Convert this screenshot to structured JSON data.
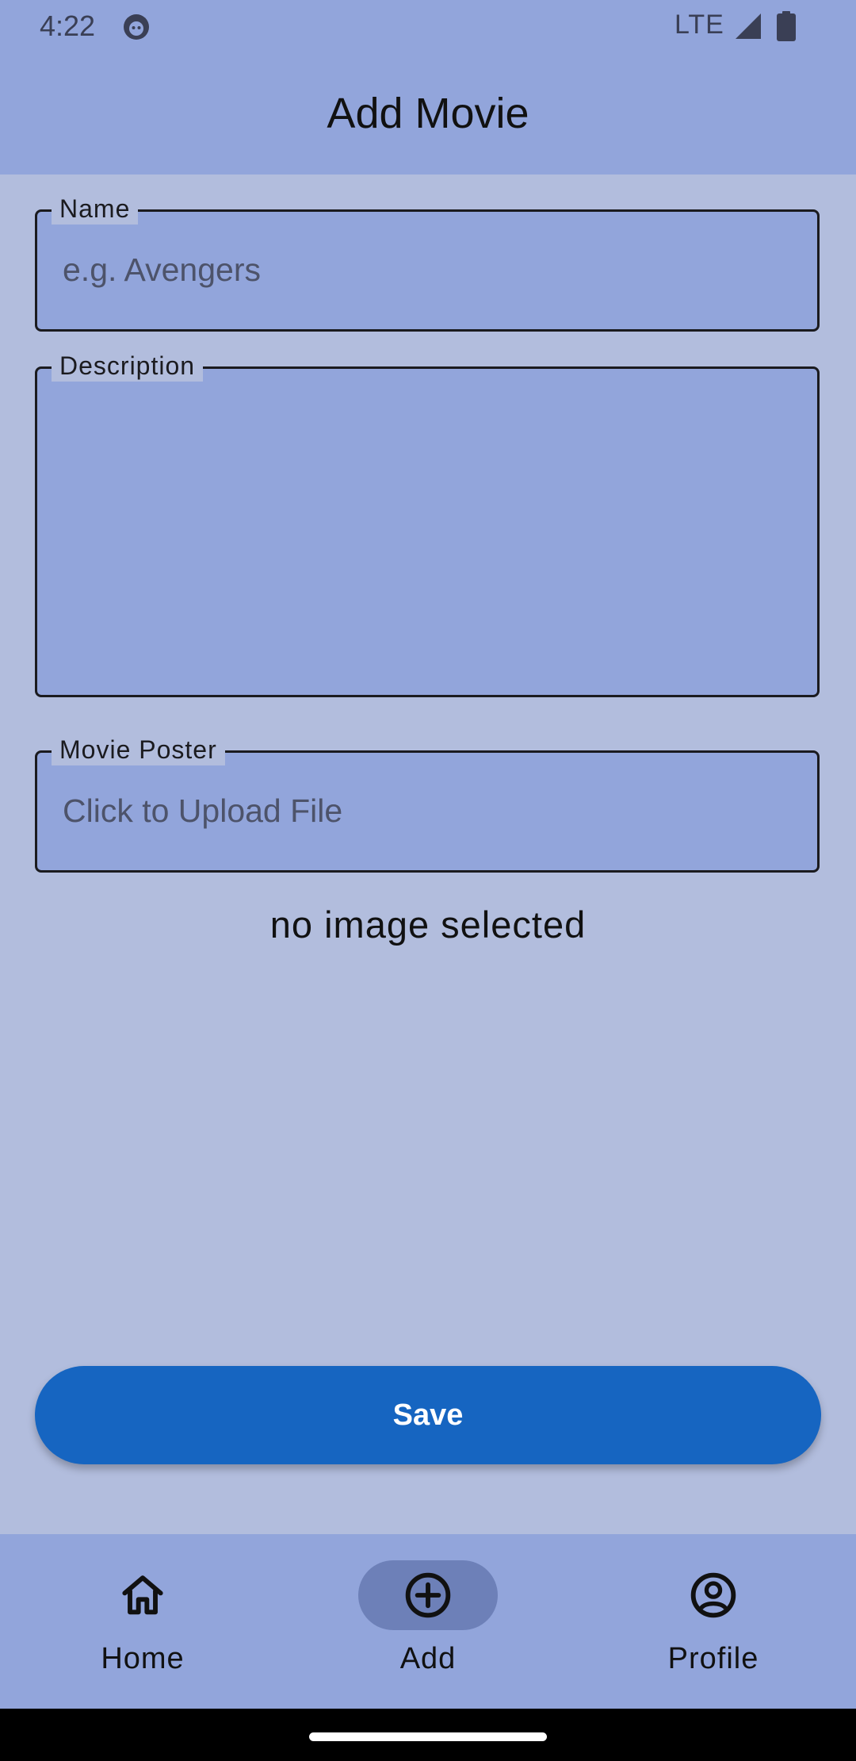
{
  "status_bar": {
    "time": "4:22",
    "network": "LTE",
    "icons": [
      "app-notification-icon",
      "signal-icon",
      "battery-icon"
    ]
  },
  "app_bar": {
    "title": "Add Movie"
  },
  "form": {
    "name": {
      "label": "Name",
      "placeholder": "e.g. Avengers",
      "value": ""
    },
    "description": {
      "label": "Description",
      "value": ""
    },
    "poster": {
      "label": "Movie Poster",
      "placeholder": "Click to Upload File"
    },
    "image_status": "no image selected"
  },
  "save_label": "Save",
  "bottom_nav": {
    "items": [
      {
        "label": "Home",
        "icon": "home-icon",
        "active": false
      },
      {
        "label": "Add",
        "icon": "add-circle-icon",
        "active": true
      },
      {
        "label": "Profile",
        "icon": "profile-icon",
        "active": false
      }
    ]
  },
  "colors": {
    "background": "#b2bddd",
    "bar": "#92a5db",
    "accent": "#1665c1",
    "nav_active_pill": "#6d80b8"
  }
}
